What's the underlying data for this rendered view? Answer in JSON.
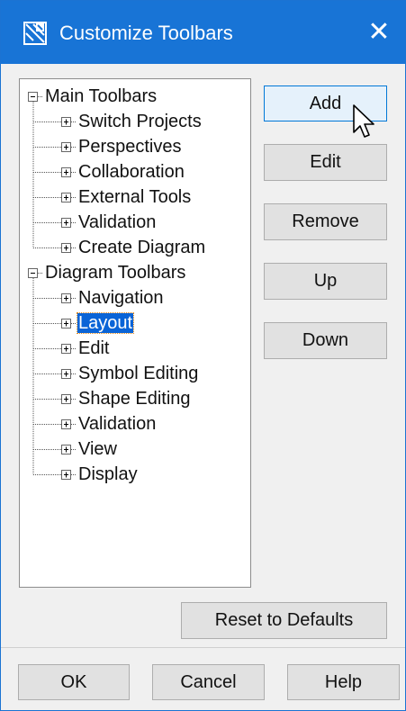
{
  "window": {
    "title": "Customize Toolbars",
    "close_label": "✕"
  },
  "tree": {
    "groups": [
      {
        "label": "Main Toolbars",
        "expand_glyph": "minus",
        "children": [
          "Switch Projects",
          "Perspectives",
          "Collaboration",
          "External Tools",
          "Validation",
          "Create Diagram"
        ]
      },
      {
        "label": "Diagram Toolbars",
        "expand_glyph": "minus",
        "children": [
          "Navigation",
          "Layout",
          "Edit",
          "Symbol Editing",
          "Shape Editing",
          "Validation",
          "View",
          "Display"
        ]
      }
    ],
    "selected": "Layout"
  },
  "side_buttons": {
    "add": "Add",
    "edit": "Edit",
    "remove": "Remove",
    "up": "Up",
    "down": "Down"
  },
  "reset_button": "Reset to Defaults",
  "footer_buttons": {
    "ok": "OK",
    "cancel": "Cancel",
    "help": "Help"
  },
  "icons": {
    "app": "diagram-app-icon",
    "close": "close-icon",
    "cursor": "mouse-pointer-icon"
  },
  "colors": {
    "titlebar": "#1874d6",
    "selection": "#0a64d7",
    "hover_button": "#e5f1fb"
  }
}
